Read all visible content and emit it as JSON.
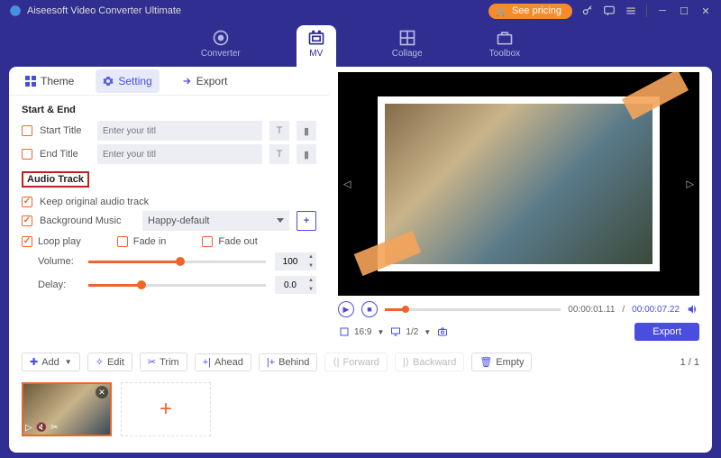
{
  "titlebar": {
    "title": "Aiseesoft Video Converter Ultimate",
    "pricing": "See pricing"
  },
  "nav": {
    "converter": "Converter",
    "mv": "MV",
    "collage": "Collage",
    "toolbox": "Toolbox"
  },
  "tabs": {
    "theme": "Theme",
    "setting": "Setting",
    "export": "Export"
  },
  "startEnd": {
    "head": "Start & End",
    "start_label": "Start Title",
    "end_label": "End Title",
    "placeholder": "Enter your titl"
  },
  "audio": {
    "head": "Audio Track",
    "keep": "Keep original audio track",
    "bgm": "Background Music",
    "bgm_value": "Happy-default",
    "loop": "Loop play",
    "fadein": "Fade in",
    "fadeout": "Fade out",
    "volume_label": "Volume:",
    "volume_val": "100",
    "delay_label": "Delay:",
    "delay_val": "0.0"
  },
  "play": {
    "current": "00:00:01.11",
    "total": "00:00:07.22",
    "ratio": "16:9",
    "scale": "1/2",
    "export": "Export"
  },
  "toolbar": {
    "add": "Add",
    "edit": "Edit",
    "trim": "Trim",
    "ahead": "Ahead",
    "behind": "Behind",
    "forward": "Forward",
    "backward": "Backward",
    "empty": "Empty",
    "page": "1 / 1"
  }
}
